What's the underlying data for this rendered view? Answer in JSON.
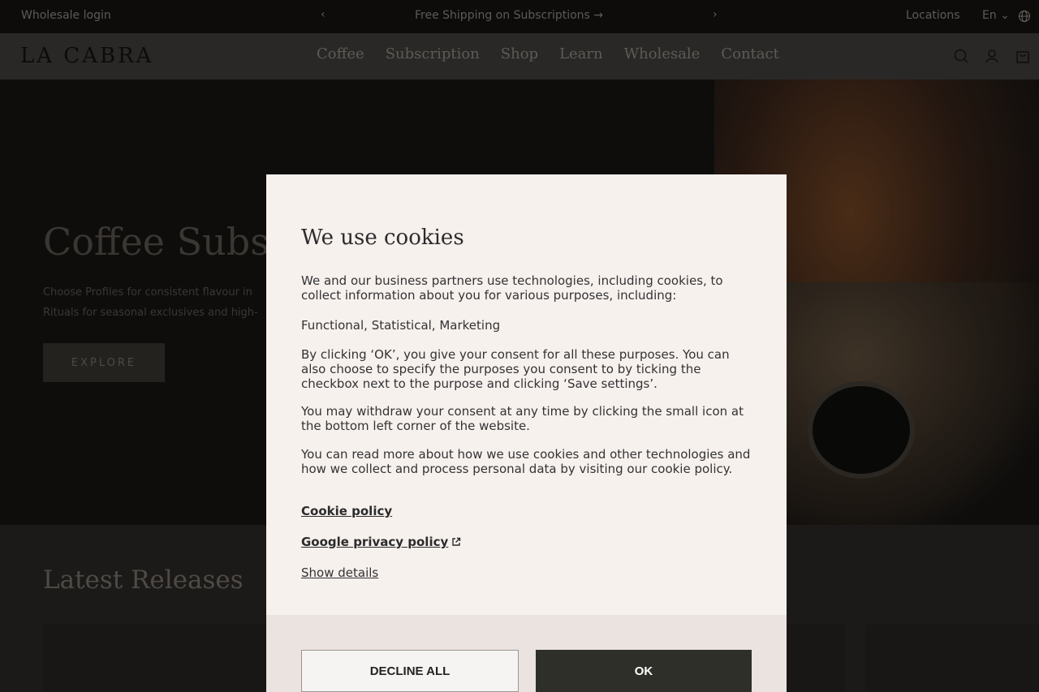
{
  "topbar": {
    "wholesale_login": "Wholesale login",
    "prev": "‹",
    "promo": "Free Shipping on Subscriptions →",
    "next": "›",
    "locations": "Locations",
    "language": "En ⌄"
  },
  "nav": {
    "logo": "LA CABRA",
    "items": [
      "Coffee",
      "Subscription",
      "Shop",
      "Learn",
      "Wholesale",
      "Contact"
    ],
    "icons": [
      "search-icon",
      "account-icon",
      "cart-icon"
    ]
  },
  "hero": {
    "title": "Coffee Subscr",
    "text": "Choose Profiles for consistent flavour in Rituals for seasonal exclusives and high-",
    "cta": "EXPLORE"
  },
  "releases": {
    "title": "Latest Releases"
  },
  "cookie_dialog": {
    "title": "We use cookies",
    "para1": "We and our business partners use technologies, including cookies, to collect information about you for various purposes, including:",
    "para2": "Functional, Statistical, Marketing",
    "para3": "By clicking ‘OK’, you give your consent for all these purposes. You can also choose to specify the purposes you consent to by ticking the checkbox next to the purpose and clicking ‘Save settings’.",
    "para4": "You may withdraw your consent at any time by clicking the small icon at the bottom left corner of the website.",
    "para5": "You can read more about how we use cookies and other technologies and how we collect and process personal data by visiting our cookie policy.",
    "cookie_policy_link": "Cookie policy",
    "google_policy_link": "Google privacy policy",
    "show_details": "Show details",
    "decline_label": "DECLINE ALL",
    "ok_label": "OK"
  },
  "colors": {
    "ok_button": "#2d2f28",
    "dialog_bg": "#f7f1ee",
    "dialog_footer": "#ebe3df"
  }
}
